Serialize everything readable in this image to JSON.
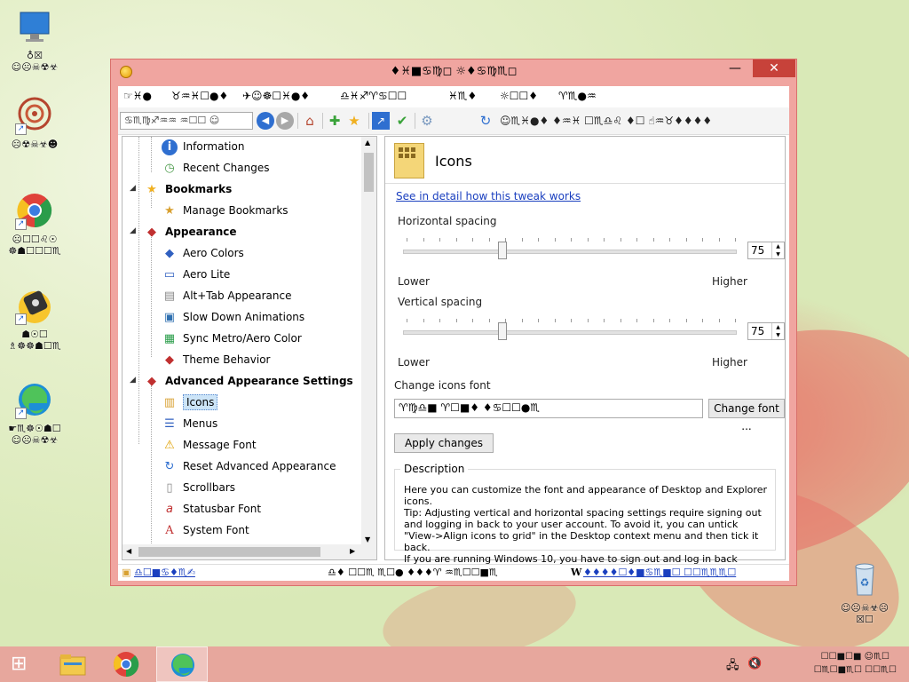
{
  "desktop": {
    "icons": [
      {
        "name": "computer-icon",
        "label": "♁☒\n☺☹☠☢☣"
      },
      {
        "name": "mandala-icon",
        "label": "☹☢☠☣☻"
      },
      {
        "name": "chrome-icon",
        "label": "☹☐☐♌☉\n☸☗☐☐☐♏"
      },
      {
        "name": "camera-app-icon",
        "label": "☗☉☐\n♗☸☸☗☐♏"
      },
      {
        "name": "edge-icon",
        "label": "☛♏☸☉☗☐\n☺☹☠☢☣"
      }
    ],
    "recycle_bin": "☺☹☠☣☹\n☒☐"
  },
  "window": {
    "title": "♦♓■♋♍◻ ☼♦♋♍♏◻",
    "controls": {
      "minimize": "—",
      "maximize": "☐",
      "close": "✕"
    }
  },
  "menu": [
    "☞♓●",
    "♉♒♓☐●♦",
    "✈☺☸☐♓●♦",
    "♎♓♐♈♋☐☐",
    "♓♏♦",
    "☼☐☐♦",
    "♈♏●♒"
  ],
  "toolbar": {
    "search_placeholder": "♋♏♍♐♒♒ ♒☐☐ ☺",
    "back": "◀",
    "forward": "▶",
    "home": "⌂",
    "add": "✚",
    "star": "★",
    "link": "↗",
    "check": "✔",
    "gear": "⚙",
    "refresh": "↻",
    "right_text": "☺♏♓●♦ ♦♒♓ ☐♏♎♌ ♦☐ ☝♒♉♦♦♦♦"
  },
  "tree": {
    "items": [
      {
        "label": "Information",
        "icon": "i",
        "level": 2,
        "group": false
      },
      {
        "label": "Recent Changes",
        "icon": "◷",
        "level": 2,
        "group": false
      },
      {
        "label": "Bookmarks",
        "icon": "★",
        "level": 1,
        "group": true
      },
      {
        "label": "Manage Bookmarks",
        "icon": "★",
        "level": 2,
        "group": false
      },
      {
        "label": "Appearance",
        "icon": "◆",
        "level": 1,
        "group": true
      },
      {
        "label": "Aero Colors",
        "icon": "◆",
        "level": 2,
        "group": false
      },
      {
        "label": "Aero Lite",
        "icon": "▭",
        "level": 2,
        "group": false
      },
      {
        "label": "Alt+Tab Appearance",
        "icon": "▤",
        "level": 2,
        "group": false
      },
      {
        "label": "Slow Down Animations",
        "icon": "▣",
        "level": 2,
        "group": false
      },
      {
        "label": "Sync Metro/Aero Color",
        "icon": "▦",
        "level": 2,
        "group": false
      },
      {
        "label": "Theme Behavior",
        "icon": "◆",
        "level": 2,
        "group": false
      },
      {
        "label": "Advanced Appearance Settings",
        "icon": "◆",
        "level": 1,
        "group": true
      },
      {
        "label": "Icons",
        "icon": "▥",
        "level": 2,
        "group": false,
        "selected": true
      },
      {
        "label": "Menus",
        "icon": "☰",
        "level": 2,
        "group": false
      },
      {
        "label": "Message Font",
        "icon": "⚠",
        "level": 2,
        "group": false
      },
      {
        "label": "Reset Advanced Appearance",
        "icon": "↻",
        "level": 2,
        "group": false
      },
      {
        "label": "Scrollbars",
        "icon": "▯",
        "level": 2,
        "group": false
      },
      {
        "label": "Statusbar Font",
        "icon": "a",
        "level": 2,
        "group": false
      },
      {
        "label": "System Font",
        "icon": "A",
        "level": 2,
        "group": false
      }
    ]
  },
  "panel": {
    "title": "Icons",
    "detail_link": "See in detail how this tweak works",
    "horizontal": {
      "label": "Horizontal spacing",
      "value": "75",
      "lower": "Lower",
      "higher": "Higher",
      "position": 0.3
    },
    "vertical": {
      "label": "Vertical spacing",
      "value": "75",
      "lower": "Lower",
      "higher": "Higher",
      "position": 0.3
    },
    "font_label": "Change icons font",
    "font_value": "♈♍♎■ ♈☐■♦ ♦♋☐☐●♏",
    "change_font_button": "Change font ...",
    "apply_button": "Apply changes",
    "description_legend": "Description",
    "description_text": "Here you can customize the font and appearance of Desktop and Explorer icons.\nTip: Adjusting vertical and horizontal spacing settings require signing out and logging in back to your user account. To avoid it, you can untick \"View->Align icons to grid\" in the Desktop context menu and then tick it back.\nIf you are running Windows 10, you have to sign out and log in back anyway."
  },
  "statusbar": {
    "left_link": "♎☐■♋♦♏✍",
    "center": "♎♦ ☐☐♏ ♏☐● ♦♦♦♈ ♒♏☐☐■♏",
    "right_link": "♦♦♦♦☐♦■♋♏■☐ ☐☐♏♏♏☐"
  },
  "taskbar": {
    "start": "⊞",
    "apps": [
      "file-explorer-icon",
      "chrome-icon",
      "edge-icon"
    ],
    "clock_line1": "☐☐■☐■ ☺♏☐",
    "clock_line2": "☐♏☐■♏☐ ☐☐♏☐"
  }
}
